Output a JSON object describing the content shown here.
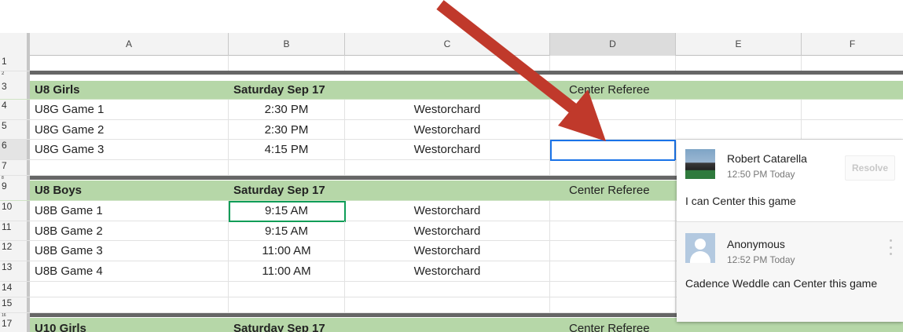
{
  "columns": [
    "A",
    "B",
    "C",
    "D",
    "E",
    "F"
  ],
  "row_numbers": {
    "r1": "1",
    "r2": "2",
    "r3": "3",
    "r4": "4",
    "r5": "5",
    "r6": "6",
    "r7": "7",
    "r8": "8",
    "r9": "9",
    "r10": "10",
    "r11": "11",
    "r12": "12",
    "r13": "13",
    "r14": "14",
    "r15": "15",
    "r16": "16",
    "r17": "17"
  },
  "groups": [
    {
      "title": "U8 Girls",
      "date": "Saturday Sep 17",
      "role": "Center Referee",
      "games": [
        {
          "name": "U8G Game 1",
          "time": "2:30 PM",
          "location": "Westorchard"
        },
        {
          "name": "U8G Game 2",
          "time": "2:30 PM",
          "location": "Westorchard"
        },
        {
          "name": "U8G Game 3",
          "time": "4:15 PM",
          "location": "Westorchard"
        }
      ]
    },
    {
      "title": "U8 Boys",
      "date": "Saturday Sep 17",
      "role": "Center Referee",
      "games": [
        {
          "name": "U8B Game 1",
          "time": "9:15 AM",
          "location": "Westorchard"
        },
        {
          "name": "U8B Game 2",
          "time": "9:15 AM",
          "location": "Westorchard"
        },
        {
          "name": "U8B Game 3",
          "time": "11:00 AM",
          "location": "Westorchard"
        },
        {
          "name": "U8B Game 4",
          "time": "11:00 AM",
          "location": "Westorchard"
        }
      ]
    },
    {
      "title": "U10 Girls",
      "date": "Saturday Sep 17",
      "role": "Center Referee",
      "games": []
    }
  ],
  "comments": [
    {
      "author": "Robert Catarella",
      "time": "12:50 PM Today",
      "text": "I can Center this game",
      "resolve_label": "Resolve",
      "avatar": "profile-photo"
    },
    {
      "author": "Anonymous",
      "time": "12:52 PM Today",
      "text": "Cadence Weddle can Center this game",
      "avatar": "anonymous-avatar"
    }
  ],
  "colors": {
    "header_green": "#b6d7a8",
    "separator": "#666666",
    "active_cell": "#1a73e8",
    "selected_cell": "#0f9d58",
    "arrow": "#c0392b"
  }
}
